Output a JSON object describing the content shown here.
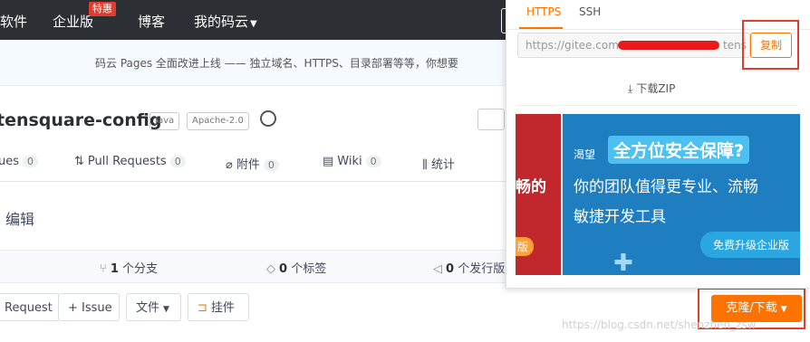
{
  "nav": {
    "items": [
      "软件",
      "企业版",
      "博客",
      "我的码云"
    ],
    "badge": "特惠"
  },
  "banner": {
    "text": "码云 Pages 全面改进上线 —— 独立域名、HTTPS、目录部署等等，你想要"
  },
  "repo": {
    "name": "tensquare-config",
    "tags": [
      "Java",
      "Apache-2.0"
    ]
  },
  "tabs": [
    {
      "label": "ues",
      "count": "0"
    },
    {
      "label": "Pull Requests",
      "count": "0"
    },
    {
      "label": "附件",
      "count": "0"
    },
    {
      "label": "Wiki",
      "count": "0"
    },
    {
      "label": "统计",
      "count": ""
    }
  ],
  "edit_label": "编辑",
  "stats": {
    "branches": {
      "num": "1",
      "label": "个分支"
    },
    "tags": {
      "num": "0",
      "label": "个标签"
    },
    "releases": {
      "num": "0",
      "label": "个发行版"
    }
  },
  "actions": {
    "request": "Request",
    "issue": "+ Issue",
    "file": "文件",
    "widget": "挂件",
    "clone": "克隆/下载"
  },
  "clone_panel": {
    "tabs": [
      "HTTPS",
      "SSH"
    ],
    "url_prefix": "https://gitee.com",
    "url_suffix": "tens",
    "copy": "复制",
    "download_zip": "下载ZIP"
  },
  "ad": {
    "left_text": "畅的",
    "left_badge": "版",
    "kicker": "渴望",
    "headline": "全方位安全保障?",
    "line2": "你的团队值得更专业、流畅",
    "line3": "敏捷开发工具",
    "cta": "免费升级企业版"
  },
  "watermark": "https://blog.csdn.net/shenzhen_zsw",
  "colors": {
    "accent": "#fe7300",
    "annotation": "#e23c2c",
    "nav_bg": "#2c3035"
  }
}
